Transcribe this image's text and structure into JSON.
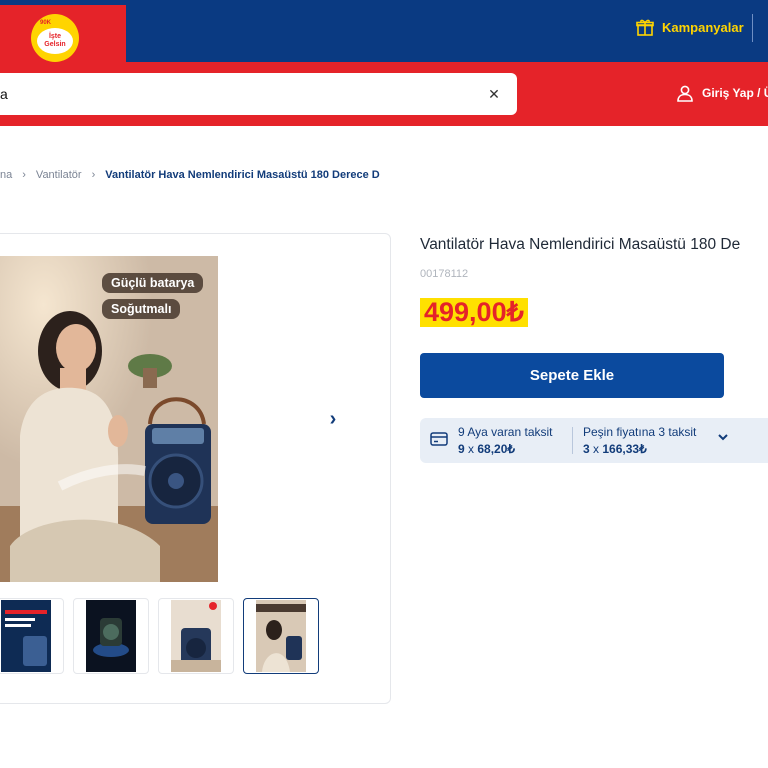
{
  "header": {
    "logo": {
      "top_text": "90K",
      "line1": "İşte",
      "line2": "Gelsin"
    },
    "campaigns_label": "Kampanyalar",
    "login_label": "Giriş Yap / Ü"
  },
  "search": {
    "value": "a",
    "clear_icon": "close-icon"
  },
  "breadcrumb": {
    "items": [
      "na",
      "Vantilatör"
    ],
    "current": "Vantilatör Hava Nemlendirici Masaüstü 180 Derece D"
  },
  "gallery": {
    "badges": [
      "Güçlü batarya",
      "Soğutmalı"
    ],
    "thumbnails_count": 4,
    "active_thumbnail": 4
  },
  "product": {
    "title": "Vantilatör Hava Nemlendirici Masaüstü 180 De",
    "sku": "00178112",
    "price": "499,00₺",
    "add_to_cart": "Sepete Ekle"
  },
  "installment": {
    "option1_title": "9 Aya varan taksit",
    "option1_count": "9",
    "option1_amount": "68,20₺",
    "option2_title": "Peşin fiyatına 3 taksit",
    "option2_count": "3",
    "option2_amount": "166,33₺",
    "times": "x"
  },
  "colors": {
    "navy": "#0a3a82",
    "red": "#e52329",
    "yellow": "#ffd400",
    "button_blue": "#0b4a9e"
  }
}
